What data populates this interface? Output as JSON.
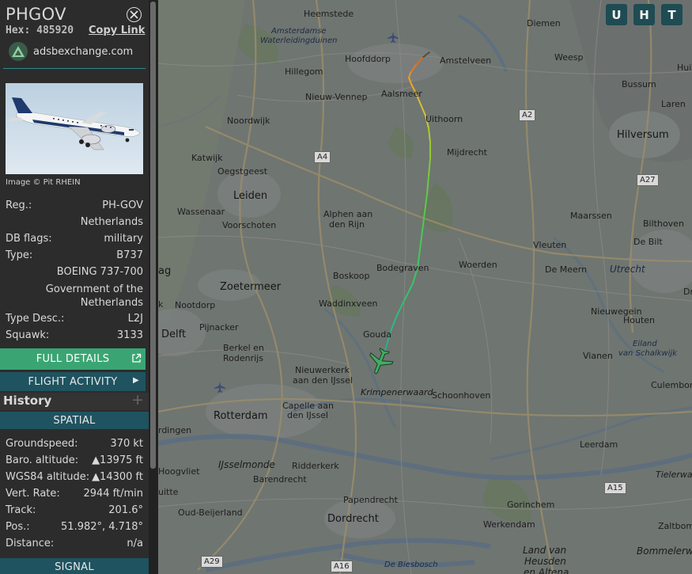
{
  "aircraft": {
    "callsign": "PHGOV",
    "hex_label": "Hex:",
    "hex_value": "485920",
    "copy_link": "Copy Link",
    "source": "adsbexchange.com",
    "photo_credit": "Image © Pit RHEIN"
  },
  "details": {
    "reg_label": "Reg.:",
    "reg_value": "PH-GOV",
    "country": "Netherlands",
    "dbflags_label": "DB flags:",
    "dbflags_value": "military",
    "type_label": "Type:",
    "type_value": "B737",
    "model": "BOEING 737-700",
    "operator_line1": "Government of the",
    "operator_line2": "Netherlands",
    "typedesc_label": "Type Desc.:",
    "typedesc_value": "L2J",
    "squawk_label": "Squawk:",
    "squawk_value": "3133"
  },
  "buttons": {
    "full_details": "FULL DETAILS",
    "flight_activity": "FLIGHT ACTIVITY",
    "history": "History"
  },
  "spatial": {
    "header": "SPATIAL",
    "groundspeed_label": "Groundspeed:",
    "groundspeed_value": "370 kt",
    "baro_label": "Baro. altitude:",
    "baro_value": "▲13975 ft",
    "wgs_label": "WGS84 altitude:",
    "wgs_value": "▲14300 ft",
    "vert_label": "Vert. Rate:",
    "vert_value": "2944 ft/min",
    "track_label": "Track:",
    "track_value": "201.6°",
    "pos_label": "Pos.:",
    "pos_value": "51.982°, 4.718°",
    "distance_label": "Distance:",
    "distance_value": "n/a"
  },
  "signal": {
    "header": "SIGNAL"
  },
  "map_buttons": {
    "u": "U",
    "h": "H",
    "t": "T"
  },
  "map_labels": {
    "heemstede": "Heemstede",
    "diemen": "Diemen",
    "amsterdamse1": "Amsterdamse",
    "amsterdamse2": "Waterleidingduinen",
    "hoofddorp": "Hoofddorp",
    "amstelveen": "Amstelveen",
    "weesp": "Weesp",
    "huiz": "Huiz",
    "hillegom": "Hillegom",
    "bussum": "Bussum",
    "nieuw_vennep": "Nieuw-Vennep",
    "aalsmeer": "Aalsmeer",
    "laren": "Laren",
    "noordwijk": "Noordwijk",
    "uithoorn": "Uithoorn",
    "a2": "A2",
    "hilversum": "Hilversum",
    "mijdrecht": "Mijdrecht",
    "katwijk": "Katwijk",
    "a4": "A4",
    "oegstgeest": "Oegstgeest",
    "a27": "A27",
    "leiden": "Leiden",
    "wassenaar": "Wassenaar",
    "alphen1": "Alphen aan",
    "alphen2": "den Rijn",
    "maarssen": "Maarssen",
    "bilthoven": "Bilthoven",
    "voorschoten": "Voorschoten",
    "de_bilt": "De Bilt",
    "vleuten": "Vleuten",
    "woerden": "Woerden",
    "de_meern": "De Meern",
    "utrecht": "Utrecht",
    "bodegraven": "Bodegraven",
    "haag": "ag",
    "boskoop": "Boskoop",
    "zoetermeer": "Zoetermeer",
    "waddinxveen": "Waddinxveen",
    "dr": "Dr",
    "noot": "Nootdorp",
    "k": "k",
    "nieuwegein": "Nieuwegein",
    "houten": "Houten",
    "delft": "Delft",
    "pijnacker": "Pijnacker",
    "gouda": "Gouda",
    "eiland1": "Eiland",
    "eiland2": "van Schalkwijk",
    "berkel1": "Berkel en",
    "berkel2": "Rodenrijs",
    "vianen": "Vianen",
    "nieuwerkerk1": "Nieuwerkerk",
    "nieuwerkerk2": "aan den IJssel",
    "culemborg": "Culemborg",
    "krimpen": "Krimpenerwaard",
    "schoonhoven": "Schoonhoven",
    "rotterdam": "Rotterdam",
    "capelle1": "Capelle aan",
    "capelle2": "den IJssel",
    "rdingen": "rdingen",
    "leerdam": "Leerdam",
    "ijsselmonde": "IJsselmonde",
    "ridderkerk": "Ridderkerk",
    "hoogvliet": "Hoogvliet",
    "barendrecht": "Barendrecht",
    "tielerwa": "Tielerwa",
    "a15": "A15",
    "uitte": "uitte",
    "papendrecht": "Papendrecht",
    "gorinchem": "Gorinchem",
    "oud_beijerland": "Oud-Beijerland",
    "dordrecht": "Dordrecht",
    "werkendam": "Werkendam",
    "zaltbomm": "Zaltbomm",
    "landvan1": "Land van",
    "landvan2": "Heusden",
    "landvan3": "en Altena",
    "bommelerw": "Bommelerwa",
    "a29": "A29",
    "a16": "A16",
    "biesbosch": "De Biesbosch"
  }
}
